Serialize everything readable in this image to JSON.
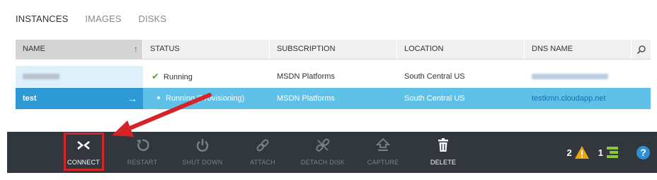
{
  "tabs": [
    {
      "label": "INSTANCES",
      "active": true
    },
    {
      "label": "IMAGES",
      "active": false
    },
    {
      "label": "DISKS",
      "active": false
    }
  ],
  "table": {
    "columns": [
      "NAME",
      "STATUS",
      "SUBSCRIPTION",
      "LOCATION",
      "DNS NAME"
    ],
    "sorted_column": "NAME",
    "rows": [
      {
        "name": "",
        "status": "Running",
        "subscription": "MSDN Platforms",
        "location": "South Central US",
        "dns": "",
        "selected": false
      },
      {
        "name": "test",
        "status": "Running (Provisioning)",
        "subscription": "MSDN Platforms",
        "location": "South Central US",
        "dns": "testkmn.cloudapp.net",
        "selected": true
      }
    ]
  },
  "command_bar": {
    "commands": [
      {
        "label": "CONNECT",
        "icon": "connect-icon",
        "enabled": true
      },
      {
        "label": "RESTART",
        "icon": "restart-icon",
        "enabled": false
      },
      {
        "label": "SHUT DOWN",
        "icon": "power-icon",
        "enabled": false
      },
      {
        "label": "ATTACH",
        "icon": "link-icon",
        "enabled": false
      },
      {
        "label": "DETACH DISK",
        "icon": "unlink-icon",
        "enabled": false
      },
      {
        "label": "CAPTURE",
        "icon": "capture-icon",
        "enabled": false
      },
      {
        "label": "DELETE",
        "icon": "trash-icon",
        "enabled": true
      }
    ],
    "warnings_count": "2",
    "tasks_count": "1",
    "help_label": "?"
  },
  "colors": {
    "accent": "#2d9ad5",
    "selected_row": "#5fc1e8",
    "command_bar": "#32373e",
    "highlight_box": "#d42426",
    "running_check": "#57a639",
    "warning": "#f0a30a",
    "tasks": "#8cc63f"
  }
}
